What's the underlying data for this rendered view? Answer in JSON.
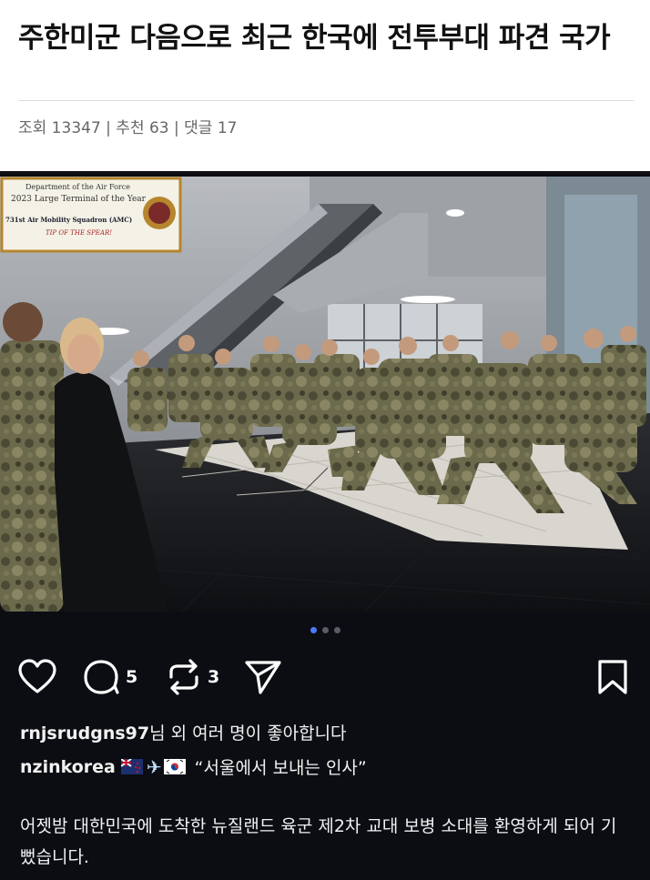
{
  "article": {
    "title": "주한미군 다음으로 최근 한국에 전투부대 파견 국가",
    "meta": "조회 13347 | 추천 63 | 댓글 17"
  },
  "photo": {
    "sign_line1": "Department of the Air Force",
    "sign_line2": "2023 Large Terminal of the Year",
    "sign_line3": "731st Air Mobility Squadron (AMC)",
    "sign_line4": "TIP OF THE SPEAR!"
  },
  "carousel": {
    "total": 3,
    "active": 1
  },
  "actions": {
    "comment_count": "5",
    "repost_count": "3"
  },
  "likes": {
    "user": "rnjsrudgns97",
    "suffix": "님 외 여러 명이 좋아합니다"
  },
  "caption": {
    "user": "nzinkorea",
    "quote": "“서울에서 보내는 인사”",
    "body": "어젯밤 대한민국에 도착한 뉴질랜드 육군 제2차 교대 보병 소대를 환영하게 되어 기뻤습니다."
  },
  "colors": {
    "dot_active": "#4a7bf5",
    "background_dark": "#0b0d12"
  }
}
